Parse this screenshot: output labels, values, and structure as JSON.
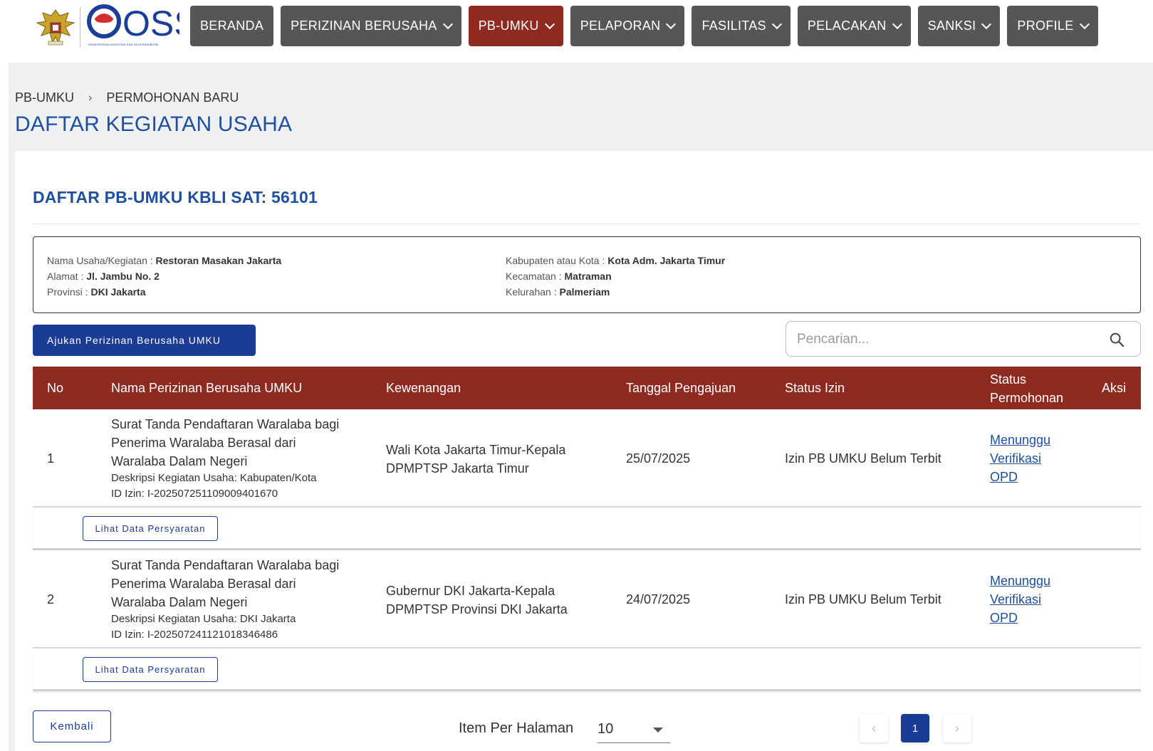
{
  "header": {
    "logo_text": "OSS",
    "logo_subtext": "KEMENTERIAN INVESTASI DAN HILIRISASI/BKPM",
    "nav": [
      {
        "label": "BERANDA",
        "dropdown": false,
        "active": false
      },
      {
        "label": "PERIZINAN BERUSAHA",
        "dropdown": true,
        "active": false
      },
      {
        "label": "PB-UMKU",
        "dropdown": true,
        "active": true
      },
      {
        "label": "PELAPORAN",
        "dropdown": true,
        "active": false
      },
      {
        "label": "FASILITAS",
        "dropdown": true,
        "active": false
      },
      {
        "label": "PELACAKAN",
        "dropdown": true,
        "active": false
      },
      {
        "label": "SANKSI",
        "dropdown": true,
        "active": false
      },
      {
        "label": "PROFILE",
        "dropdown": true,
        "active": false
      }
    ]
  },
  "breadcrumb": {
    "items": [
      "PB-UMKU",
      "PERMOHONAN BARU"
    ],
    "separator": "›"
  },
  "page_title": "DAFTAR KEGIATAN USAHA",
  "card": {
    "title": "DAFTAR PB-UMKU KBLI SAT: 56101",
    "info": {
      "left": [
        {
          "label": "Nama Usaha/Kegiatan : ",
          "value": "Restoran Masakan Jakarta"
        },
        {
          "label": "Alamat : ",
          "value": "Jl. Jambu No. 2"
        },
        {
          "label": "Provinsi : ",
          "value": "DKI Jakarta"
        }
      ],
      "right": [
        {
          "label": "Kabupaten atau Kota : ",
          "value": "Kota Adm. Jakarta Timur"
        },
        {
          "label": "Kecamatan : ",
          "value": "Matraman"
        },
        {
          "label": "Kelurahan : ",
          "value": "Palmeriam"
        }
      ]
    },
    "submit_button": "Ajukan Perizinan Berusaha UMKU",
    "search": {
      "placeholder": "Pencarian..."
    }
  },
  "table": {
    "headers": {
      "no": "No",
      "name": "Nama Perizinan Berusaha UMKU",
      "authority": "Kewenangan",
      "date": "Tanggal Pengajuan",
      "permit_status": "Status Izin",
      "request_status_1": "Status",
      "request_status_2": "Permohonan",
      "action": "Aksi"
    },
    "rows": [
      {
        "no": "1",
        "name_lines": [
          "Surat Tanda Pendaftaran Waralaba bagi",
          "Penerima Waralaba Berasal dari",
          "Waralaba Dalam Negeri"
        ],
        "description": "Deskripsi Kegiatan Usaha: Kabupaten/Kota",
        "permit_id": "ID Izin: I-202507251109009401670",
        "authority_lines": [
          "Wali Kota Jakarta Timur-Kepala",
          "DPMPTSP Jakarta Timur"
        ],
        "date": "25/07/2025",
        "permit_status": "Izin PB UMKU Belum Terbit",
        "request_status_lines": [
          "Menunggu",
          "Verifikasi",
          "OPD"
        ],
        "requirements_button": "Lihat Data Persyaratan"
      },
      {
        "no": "2",
        "name_lines": [
          "Surat Tanda Pendaftaran Waralaba bagi",
          "Penerima Waralaba Berasal dari",
          "Waralaba Dalam Negeri"
        ],
        "description": "Deskripsi Kegiatan Usaha: DKI Jakarta",
        "permit_id": "ID Izin: I-202507241121018346486",
        "authority_lines": [
          "Gubernur DKI Jakarta-Kepala",
          "DPMPTSP Provinsi DKI Jakarta"
        ],
        "date": "24/07/2025",
        "permit_status": "Izin PB UMKU Belum Terbit",
        "request_status_lines": [
          "Menunggu",
          "Verifikasi",
          "OPD"
        ],
        "requirements_button": "Lihat Data Persyaratan"
      }
    ]
  },
  "footer": {
    "back_button": "Kembali",
    "per_page_label": "Item Per Halaman",
    "per_page_value": "10",
    "pagination": {
      "prev": "‹",
      "current": "1",
      "next": "›"
    }
  },
  "colors": {
    "primary": "#1a3c96",
    "accent_red": "#8f2a20",
    "nav_grey": "#565656",
    "title_blue": "#1e4fa0"
  },
  "icons": {
    "search": "search-icon",
    "nav_dropdown": "chevron-down-icon",
    "emblem": "garuda-emblem-icon"
  }
}
